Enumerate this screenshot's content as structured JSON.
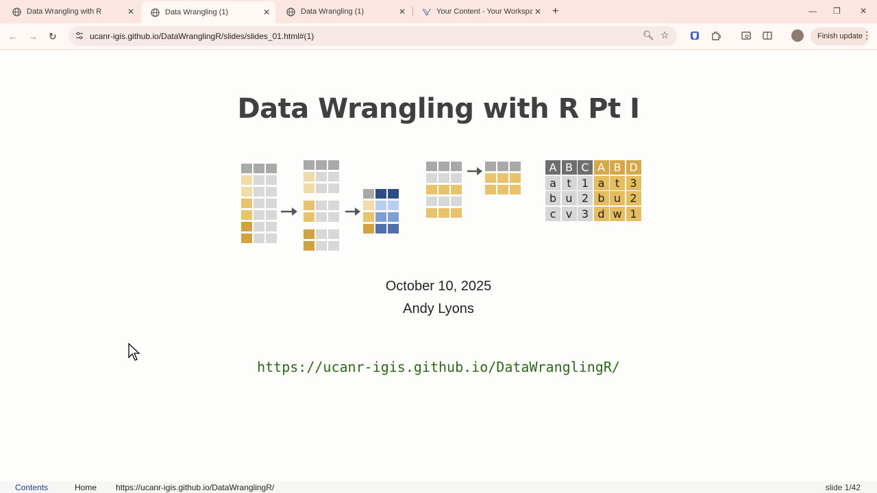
{
  "browser": {
    "tabs": [
      {
        "title": "Data Wrangling with R",
        "active": false
      },
      {
        "title": "Data Wrangling (1)",
        "active": true
      },
      {
        "title": "Data Wrangling (1)",
        "active": false
      },
      {
        "title": "Your Content - Your Workspace",
        "active": false
      }
    ],
    "new_tab_label": "+",
    "url": "ucanr-igis.github.io/DataWranglingR/slides/slides_01.html#(1)",
    "finish_update_label": "Finish update"
  },
  "slide": {
    "title": "Data Wrangling with R Pt I",
    "date": "October 10, 2025",
    "author": "Andy Lyons",
    "link": "https://ucanr-igis.github.io/DataWranglingR/",
    "pivot_table": {
      "headers": [
        "A",
        "B",
        "C",
        "A",
        "B",
        "D"
      ],
      "rows": [
        [
          "a",
          "t",
          "1",
          "a",
          "t",
          "3"
        ],
        [
          "b",
          "u",
          "2",
          "b",
          "u",
          "2"
        ],
        [
          "c",
          "v",
          "3",
          "d",
          "w",
          "1"
        ]
      ]
    }
  },
  "footer": {
    "contents_label": "Contents",
    "home_label": "Home",
    "link_text": "https://ucanr-igis.github.io/DataWranglingR/",
    "slide_counter": "slide 1/42"
  },
  "colors": {
    "accent_gold": "#e0b54f",
    "grey_cell": "#d8d8d8",
    "dark_grey_cell": "#a9a9a9",
    "navy": "#2b4c86",
    "link_green": "#2e6a16"
  }
}
